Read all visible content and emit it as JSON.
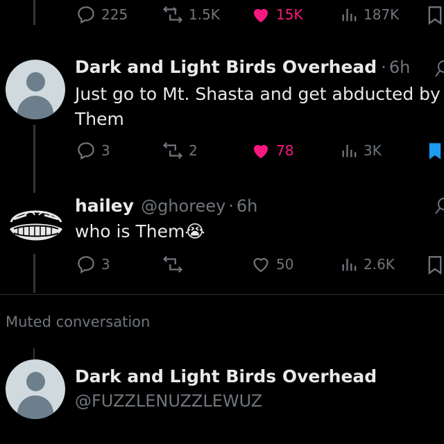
{
  "top_actions": {
    "replies": "225",
    "reposts": "1.5K",
    "likes": "15K",
    "views": "187K",
    "liked": true
  },
  "tweets": [
    {
      "display_name": "Dark and Light Birds Overhead",
      "separator": "·",
      "time": "6h",
      "text_line1": "Just go to Mt. Shasta and get abducted by",
      "text_line2": "Them",
      "replies": "3",
      "reposts": "2",
      "likes": "78",
      "views": "3K",
      "liked": true,
      "bookmarked": true
    },
    {
      "display_name": "hailey",
      "handle": "@ghoreey",
      "separator": "·",
      "time": "6h",
      "text": "who is Them",
      "emoji": "😭",
      "replies": "3",
      "reposts": "",
      "likes": "50",
      "views": "2.6K",
      "liked": false,
      "bookmarked": false
    }
  ],
  "muted": {
    "label": "Muted conversation"
  },
  "profile": {
    "display_name": "Dark and Light Birds Overhead",
    "handle": "@FUZZLENUZZLEWUZ"
  },
  "colors": {
    "background": "#000000",
    "text": "#e7e9ea",
    "secondary": "#71767b",
    "like": "#f91880",
    "bookmark": "#1d9bf0",
    "line": "#333639"
  },
  "icons": [
    "reply-icon",
    "repost-icon",
    "like-icon",
    "views-icon",
    "bookmark-icon",
    "grok-icon",
    "default-avatar-icon"
  ]
}
